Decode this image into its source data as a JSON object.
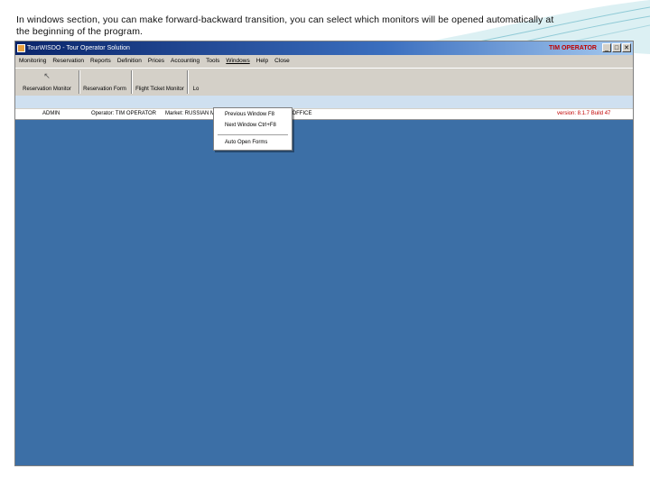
{
  "caption": "In windows section, you can make forward-backward transition, you can select which monitors will be opened automatically at the beginning of the program.",
  "window": {
    "title": "TourWISDO - Tour Operator Solution",
    "mode": "TIM OPERATOR",
    "buttons": {
      "minimize": "_",
      "maximize": "□",
      "close": "✕"
    }
  },
  "menubar": {
    "items": [
      "Monitoring",
      "Reservation",
      "Reports",
      "Definition",
      "Prices",
      "Accounting",
      "Tools",
      "Windows",
      "Help",
      "Close"
    ]
  },
  "toolbar": {
    "buttons": [
      {
        "label": "Reservation Monitor",
        "icon": "cursor-icon"
      },
      {
        "label": "Reservation Form",
        "icon": "form-icon"
      },
      {
        "label": "Flight Ticket Monitor",
        "icon": "ticket-icon"
      },
      {
        "label": "Lo",
        "icon": "logout-icon"
      }
    ]
  },
  "windows_menu": {
    "items": [
      "Previous Window    F8",
      "Next Window    Ctrl+F8",
      "Auto Open Forms"
    ]
  },
  "statusbar": {
    "user": "ADMIN",
    "operator": "Operator: TIM OPERATOR",
    "market": "Market: RUSSIAN MARKET",
    "clients": "Clients: OPERATOR OFFICE",
    "version": "version: 8.1.7 Build 47"
  },
  "colors": {
    "workspace": "#3c6fa6",
    "titlebar": "#0a246a",
    "band": "#cfe0f0"
  }
}
